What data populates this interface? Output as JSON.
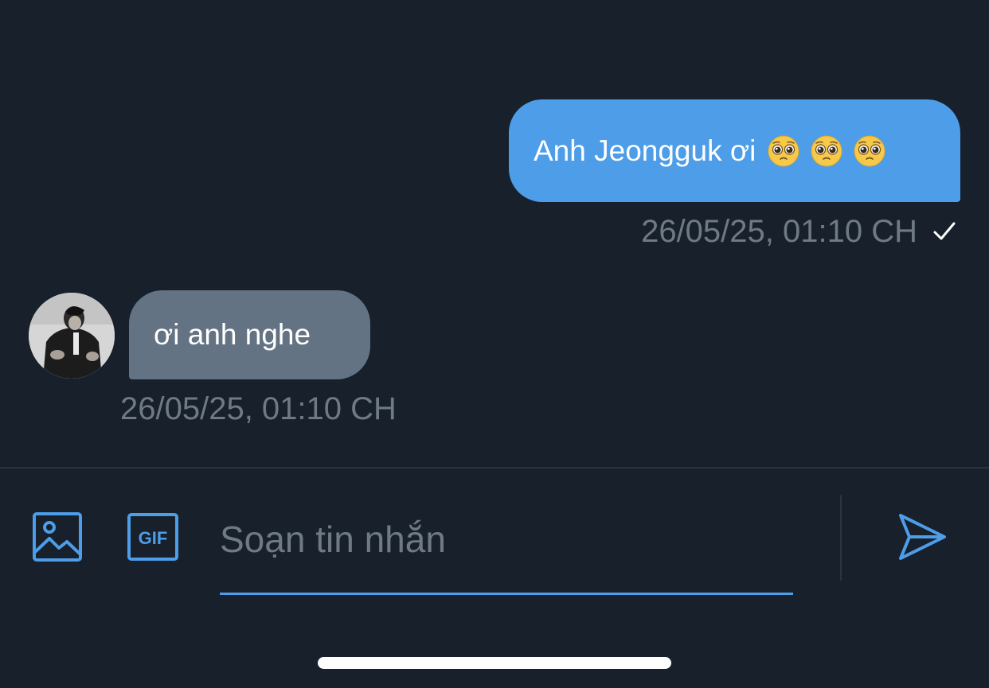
{
  "messages": [
    {
      "direction": "sent",
      "text": "Anh Jeongguk ơi",
      "emojis": [
        "pleading-face-emoji",
        "pleading-face-emoji",
        "pleading-face-emoji"
      ],
      "timestamp": "26/05/25, 01:10 CH",
      "status_icon": "check-icon"
    },
    {
      "direction": "received",
      "text": "ơi anh nghe",
      "timestamp": "26/05/25, 01:10 CH",
      "avatar_icon": "avatar"
    }
  ],
  "composer": {
    "image_icon": "image-icon",
    "gif_label": "GIF",
    "placeholder": "Soạn tin nhắn",
    "value": "",
    "send_icon": "send-icon"
  },
  "colors": {
    "background": "#17202b",
    "sent_bubble": "#4d9de8",
    "received_bubble": "#647383",
    "timestamp_text": "#6f7a87",
    "accent": "#4d9de8"
  }
}
